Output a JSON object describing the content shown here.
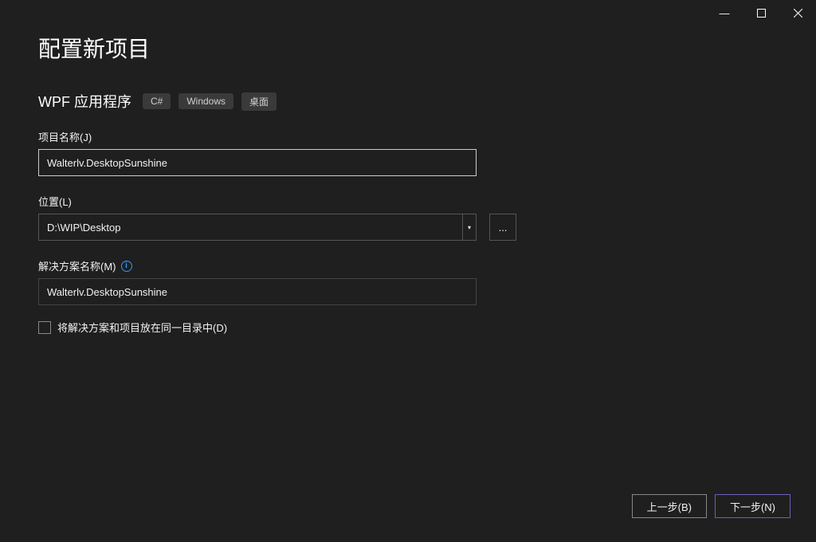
{
  "window": {
    "minimize_glyph": "—",
    "maximize_glyph": "▢",
    "close_glyph": "✕"
  },
  "heading": "配置新项目",
  "template": {
    "name": "WPF 应用程序",
    "tags": [
      "C#",
      "Windows",
      "桌面"
    ]
  },
  "project_name": {
    "label": "项目名称(J)",
    "value": "Walterlv.DesktopSunshine"
  },
  "location": {
    "label": "位置(L)",
    "value": "D:\\WIP\\Desktop",
    "dropdown_glyph": "▾",
    "browse_glyph": "..."
  },
  "solution_name": {
    "label": "解决方案名称(M)",
    "info_glyph": "i",
    "value": "Walterlv.DesktopSunshine"
  },
  "same_directory": {
    "label": "将解决方案和项目放在同一目录中(D)",
    "checked": false
  },
  "buttons": {
    "back": "上一步(B)",
    "next": "下一步(N)"
  }
}
